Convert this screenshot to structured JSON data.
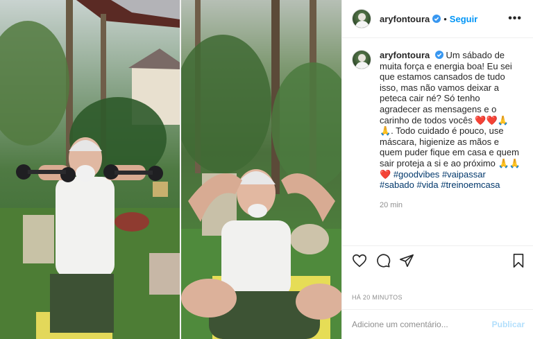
{
  "post": {
    "username": "aryfontoura",
    "follow_label": "Seguir",
    "separator": "•",
    "more_label": "•••",
    "caption_parts": [
      {
        "type": "text",
        "value": "Um sábado de muita força e energia boa! Eu sei que estamos cansados de tudo isso, mas não vamos deixar a peteca cair né? Só tenho agradecer as mensagens e o carinho de todos vocês ❤️❤️🙏🙏. Todo cuidado é pouco, use máscara, higienize as mãos e quem puder fique em casa e quem sair proteja a si e ao próximo 🙏🙏❤️ "
      },
      {
        "type": "hashtag",
        "value": "#goodvibes"
      },
      {
        "type": "text",
        "value": " "
      },
      {
        "type": "hashtag",
        "value": "#vaipassar"
      },
      {
        "type": "text",
        "value": " "
      },
      {
        "type": "hashtag",
        "value": "#sabado"
      },
      {
        "type": "text",
        "value": " "
      },
      {
        "type": "hashtag",
        "value": "#vida"
      },
      {
        "type": "text",
        "value": " "
      },
      {
        "type": "hashtag",
        "value": "#treinoemcasa"
      }
    ],
    "caption_time": "20 min",
    "timestamp": "HÁ 20 MINUTOS",
    "comment_placeholder": "Adicione um comentário...",
    "publish_label": "Publicar"
  },
  "icons": {
    "like": "heart-icon",
    "comment": "comment-icon",
    "share": "share-icon",
    "save": "bookmark-icon",
    "verified": "verified-badge-icon"
  },
  "colors": {
    "accent": "#0095f6",
    "hashtag": "#00376b",
    "muted": "#8e8e8e",
    "publish_disabled": "#b2dffc"
  }
}
